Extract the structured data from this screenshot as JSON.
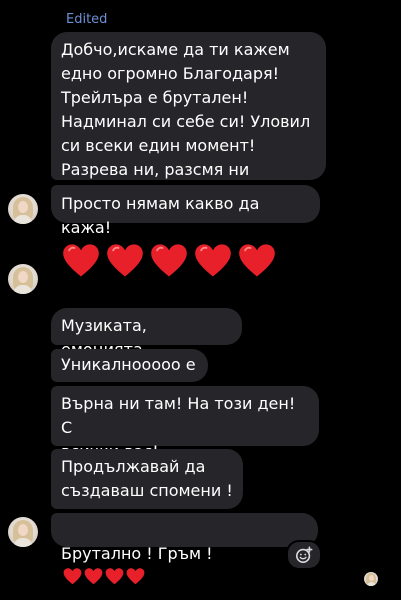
{
  "edited_label": "Edited",
  "messages": [
    {
      "text": "Добчо,искаме да ти кажем\nедно огромно Благодаря!\nТрейлъра е брутален!\nНадминал си себе си! Уловил\nси всеки един момент!\nРазрева ни, разсмя ни"
    },
    {
      "text": "Просто нямам какво да кажа!"
    },
    {
      "text": "Музиката, емоцията"
    },
    {
      "text": "Уникалнооооо е"
    },
    {
      "text": "Върна ни там! На този ден! С\nвсички вас!"
    },
    {
      "text": "Продължавай да\nсъздаваш спомени !"
    },
    {
      "text": "Брутално ! Гръм !"
    }
  ],
  "hearts_message": {
    "count": 5,
    "emoji": "red-heart"
  },
  "last_message_hearts": 4,
  "colors": {
    "background": "#000000",
    "bubble": "#26262a",
    "heart": "#e8202a",
    "edited_label": "#6e8fd6"
  },
  "icons": {
    "reaction_button": "add-reaction-smiley-icon",
    "avatar": "sender-avatar",
    "seen_avatar": "seen-avatar"
  }
}
